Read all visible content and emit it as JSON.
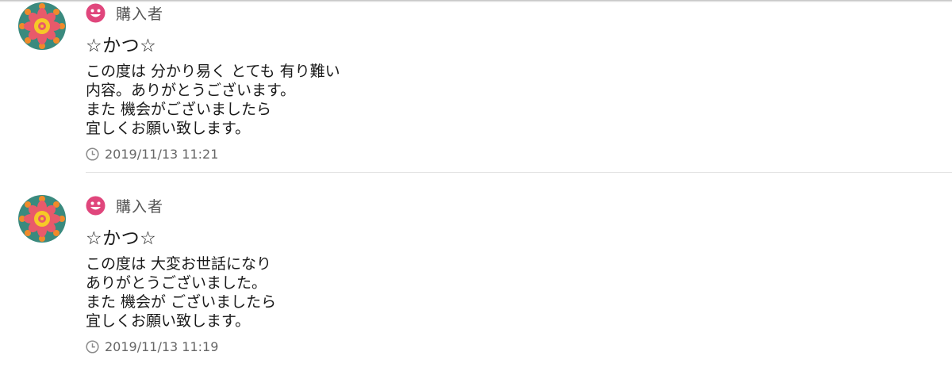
{
  "colors": {
    "smile": "#e0467c",
    "avatar_ring": "#3a8a7e",
    "avatar_petal": "#e85a6a",
    "avatar_center": "#f6c927",
    "divider": "#e3e3e3"
  },
  "reviews": [
    {
      "avatar_icon": "flower-avatar",
      "role_icon": "smile-icon",
      "role": "購入者",
      "username": "☆かつ☆",
      "lines": [
        "この度は 分かり易く とても 有り難い",
        "内容。ありがとうございます。",
        "また 機会がございましたら",
        "宜しくお願い致します。"
      ],
      "time_icon": "clock-icon",
      "timestamp": "2019/11/13 11:21"
    },
    {
      "avatar_icon": "flower-avatar",
      "role_icon": "smile-icon",
      "role": "購入者",
      "username": "☆かつ☆",
      "lines": [
        "この度は 大変お世話になり",
        "ありがとうございました。",
        "また 機会が ございましたら",
        "宜しくお願い致します。"
      ],
      "time_icon": "clock-icon",
      "timestamp": "2019/11/13 11:19"
    }
  ]
}
